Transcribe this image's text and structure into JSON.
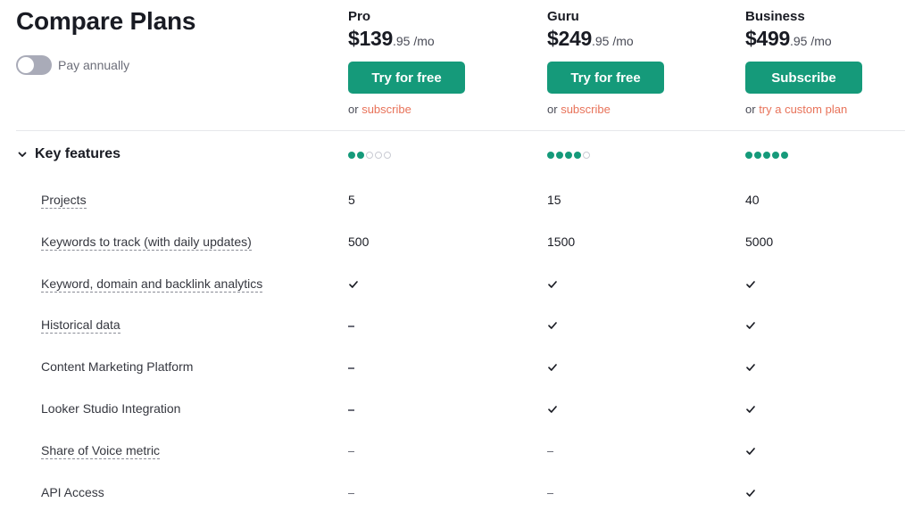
{
  "header": {
    "title": "Compare Plans",
    "toggle_label": "Pay annually",
    "toggle_on": false
  },
  "colors": {
    "accent": "#159a7a",
    "link": "#e8735a",
    "toggle_off": "#a9abb8"
  },
  "plans": [
    {
      "name": "Pro",
      "price_main": "$139",
      "price_cents": ".95 /mo",
      "cta_label": "Try for free",
      "alt_prefix": "or",
      "alt_link": "subscribe",
      "level": 2,
      "level_max": 5
    },
    {
      "name": "Guru",
      "price_main": "$249",
      "price_cents": ".95 /mo",
      "cta_label": "Try for free",
      "alt_prefix": "or",
      "alt_link": "subscribe",
      "level": 4,
      "level_max": 5
    },
    {
      "name": "Business",
      "price_main": "$499",
      "price_cents": ".95 /mo",
      "cta_label": "Subscribe",
      "alt_prefix": "or",
      "alt_link": "try a custom plan",
      "level": 5,
      "level_max": 5
    }
  ],
  "section": {
    "title": "Key features",
    "expanded": true,
    "icon": "chevron-down-icon"
  },
  "features": [
    {
      "label": "Projects",
      "tooltip": true,
      "values": [
        "5",
        "15",
        "40"
      ]
    },
    {
      "label": "Keywords to track (with daily updates)",
      "tooltip": true,
      "values": [
        "500",
        "1500",
        "5000"
      ]
    },
    {
      "label": "Keyword, domain and backlink analytics",
      "tooltip": true,
      "values": [
        "check",
        "check",
        "check"
      ]
    },
    {
      "label": "Historical data",
      "tooltip": true,
      "values": [
        "dash",
        "check",
        "check"
      ]
    },
    {
      "label": "Content Marketing Platform",
      "tooltip": false,
      "values": [
        "dash",
        "check",
        "check"
      ]
    },
    {
      "label": "Looker Studio Integration",
      "tooltip": false,
      "values": [
        "dash",
        "check",
        "check"
      ]
    },
    {
      "label": "Share of Voice metric",
      "tooltip": true,
      "values": [
        "dash",
        "dash",
        "check"
      ]
    },
    {
      "label": "API Access",
      "tooltip": false,
      "values": [
        "dash",
        "dash",
        "check"
      ]
    }
  ]
}
